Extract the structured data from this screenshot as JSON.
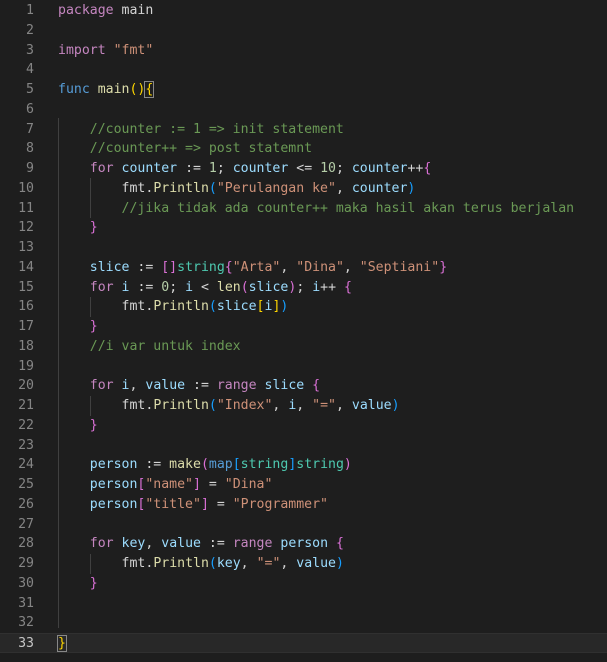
{
  "editor": {
    "language": "Go",
    "theme_background": "#1e1e1e",
    "current_line": 33,
    "lines": [
      {
        "n": "1",
        "tokens": [
          [
            "kw",
            "package"
          ],
          [
            "op",
            " "
          ],
          [
            "plain",
            "main"
          ]
        ]
      },
      {
        "n": "2",
        "tokens": []
      },
      {
        "n": "3",
        "tokens": [
          [
            "kw",
            "import"
          ],
          [
            "op",
            " "
          ],
          [
            "str",
            "\"fmt\""
          ]
        ]
      },
      {
        "n": "4",
        "tokens": []
      },
      {
        "n": "5",
        "tokens": [
          [
            "kwb",
            "func"
          ],
          [
            "op",
            " "
          ],
          [
            "fn",
            "main"
          ],
          [
            "br1",
            "()"
          ],
          [
            "br1m",
            "{"
          ]
        ]
      },
      {
        "n": "6",
        "tokens": []
      },
      {
        "n": "7",
        "tokens": [
          [
            "ws",
            "    "
          ],
          [
            "cm",
            "//counter := 1 => init statement"
          ]
        ]
      },
      {
        "n": "8",
        "tokens": [
          [
            "ws",
            "    "
          ],
          [
            "cm",
            "//counter++ => post statemnt"
          ]
        ]
      },
      {
        "n": "9",
        "tokens": [
          [
            "ws",
            "    "
          ],
          [
            "kw",
            "for"
          ],
          [
            "op",
            " "
          ],
          [
            "var",
            "counter"
          ],
          [
            "op",
            " := "
          ],
          [
            "num",
            "1"
          ],
          [
            "op",
            "; "
          ],
          [
            "var",
            "counter"
          ],
          [
            "op",
            " <= "
          ],
          [
            "num",
            "10"
          ],
          [
            "op",
            "; "
          ],
          [
            "var",
            "counter"
          ],
          [
            "op",
            "++"
          ],
          [
            "br2",
            "{"
          ]
        ]
      },
      {
        "n": "10",
        "tokens": [
          [
            "ws",
            "        "
          ],
          [
            "plain",
            "fmt"
          ],
          [
            "op",
            "."
          ],
          [
            "fn",
            "Println"
          ],
          [
            "br3",
            "("
          ],
          [
            "str",
            "\"Perulangan ke\""
          ],
          [
            "op",
            ", "
          ],
          [
            "var",
            "counter"
          ],
          [
            "br3",
            ")"
          ]
        ]
      },
      {
        "n": "11",
        "tokens": [
          [
            "ws",
            "        "
          ],
          [
            "cm",
            "//jika tidak ada counter++ maka hasil akan terus berjalan"
          ]
        ]
      },
      {
        "n": "12",
        "tokens": [
          [
            "ws",
            "    "
          ],
          [
            "br2",
            "}"
          ]
        ]
      },
      {
        "n": "13",
        "tokens": []
      },
      {
        "n": "14",
        "tokens": [
          [
            "ws",
            "    "
          ],
          [
            "var",
            "slice"
          ],
          [
            "op",
            " := "
          ],
          [
            "br2",
            "[]"
          ],
          [
            "typ",
            "string"
          ],
          [
            "br2",
            "{"
          ],
          [
            "str",
            "\"Arta\""
          ],
          [
            "op",
            ", "
          ],
          [
            "str",
            "\"Dina\""
          ],
          [
            "op",
            ", "
          ],
          [
            "str",
            "\"Septiani\""
          ],
          [
            "br2",
            "}"
          ]
        ]
      },
      {
        "n": "15",
        "tokens": [
          [
            "ws",
            "    "
          ],
          [
            "kw",
            "for"
          ],
          [
            "op",
            " "
          ],
          [
            "var",
            "i"
          ],
          [
            "op",
            " := "
          ],
          [
            "num",
            "0"
          ],
          [
            "op",
            "; "
          ],
          [
            "var",
            "i"
          ],
          [
            "op",
            " < "
          ],
          [
            "fn",
            "len"
          ],
          [
            "br2",
            "("
          ],
          [
            "var",
            "slice"
          ],
          [
            "br2",
            ")"
          ],
          [
            "op",
            "; "
          ],
          [
            "var",
            "i"
          ],
          [
            "op",
            "++ "
          ],
          [
            "br2",
            "{"
          ]
        ]
      },
      {
        "n": "16",
        "tokens": [
          [
            "ws",
            "        "
          ],
          [
            "plain",
            "fmt"
          ],
          [
            "op",
            "."
          ],
          [
            "fn",
            "Println"
          ],
          [
            "br3",
            "("
          ],
          [
            "var",
            "slice"
          ],
          [
            "br1",
            "["
          ],
          [
            "var",
            "i"
          ],
          [
            "br1",
            "]"
          ],
          [
            "br3",
            ")"
          ]
        ]
      },
      {
        "n": "17",
        "tokens": [
          [
            "ws",
            "    "
          ],
          [
            "br2",
            "}"
          ]
        ]
      },
      {
        "n": "18",
        "tokens": [
          [
            "ws",
            "    "
          ],
          [
            "cm",
            "//i var untuk index"
          ]
        ]
      },
      {
        "n": "19",
        "tokens": []
      },
      {
        "n": "20",
        "tokens": [
          [
            "ws",
            "    "
          ],
          [
            "kw",
            "for"
          ],
          [
            "op",
            " "
          ],
          [
            "var",
            "i"
          ],
          [
            "op",
            ", "
          ],
          [
            "var",
            "value"
          ],
          [
            "op",
            " := "
          ],
          [
            "kw",
            "range"
          ],
          [
            "op",
            " "
          ],
          [
            "var",
            "slice"
          ],
          [
            "op",
            " "
          ],
          [
            "br2",
            "{"
          ]
        ]
      },
      {
        "n": "21",
        "tokens": [
          [
            "ws",
            "        "
          ],
          [
            "plain",
            "fmt"
          ],
          [
            "op",
            "."
          ],
          [
            "fn",
            "Println"
          ],
          [
            "br3",
            "("
          ],
          [
            "str",
            "\"Index\""
          ],
          [
            "op",
            ", "
          ],
          [
            "var",
            "i"
          ],
          [
            "op",
            ", "
          ],
          [
            "str",
            "\"=\""
          ],
          [
            "op",
            ", "
          ],
          [
            "var",
            "value"
          ],
          [
            "br3",
            ")"
          ]
        ]
      },
      {
        "n": "22",
        "tokens": [
          [
            "ws",
            "    "
          ],
          [
            "br2",
            "}"
          ]
        ]
      },
      {
        "n": "23",
        "tokens": []
      },
      {
        "n": "24",
        "tokens": [
          [
            "ws",
            "    "
          ],
          [
            "var",
            "person"
          ],
          [
            "op",
            " := "
          ],
          [
            "fn",
            "make"
          ],
          [
            "br2",
            "("
          ],
          [
            "kwb",
            "map"
          ],
          [
            "br3",
            "["
          ],
          [
            "typ",
            "string"
          ],
          [
            "br3",
            "]"
          ],
          [
            "typ",
            "string"
          ],
          [
            "br2",
            ")"
          ]
        ]
      },
      {
        "n": "25",
        "tokens": [
          [
            "ws",
            "    "
          ],
          [
            "var",
            "person"
          ],
          [
            "br2",
            "["
          ],
          [
            "str",
            "\"name\""
          ],
          [
            "br2",
            "]"
          ],
          [
            "op",
            " = "
          ],
          [
            "str",
            "\"Dina\""
          ]
        ]
      },
      {
        "n": "26",
        "tokens": [
          [
            "ws",
            "    "
          ],
          [
            "var",
            "person"
          ],
          [
            "br2",
            "["
          ],
          [
            "str",
            "\"title\""
          ],
          [
            "br2",
            "]"
          ],
          [
            "op",
            " = "
          ],
          [
            "str",
            "\"Programmer\""
          ]
        ]
      },
      {
        "n": "27",
        "tokens": []
      },
      {
        "n": "28",
        "tokens": [
          [
            "ws",
            "    "
          ],
          [
            "kw",
            "for"
          ],
          [
            "op",
            " "
          ],
          [
            "var",
            "key"
          ],
          [
            "op",
            ", "
          ],
          [
            "var",
            "value"
          ],
          [
            "op",
            " := "
          ],
          [
            "kw",
            "range"
          ],
          [
            "op",
            " "
          ],
          [
            "var",
            "person"
          ],
          [
            "op",
            " "
          ],
          [
            "br2",
            "{"
          ]
        ]
      },
      {
        "n": "29",
        "tokens": [
          [
            "ws",
            "        "
          ],
          [
            "plain",
            "fmt"
          ],
          [
            "op",
            "."
          ],
          [
            "fn",
            "Println"
          ],
          [
            "br3",
            "("
          ],
          [
            "var",
            "key"
          ],
          [
            "op",
            ", "
          ],
          [
            "str",
            "\"=\""
          ],
          [
            "op",
            ", "
          ],
          [
            "var",
            "value"
          ],
          [
            "br3",
            ")"
          ]
        ]
      },
      {
        "n": "30",
        "tokens": [
          [
            "ws",
            "    "
          ],
          [
            "br2",
            "}"
          ]
        ]
      },
      {
        "n": "31",
        "tokens": []
      },
      {
        "n": "32",
        "tokens": []
      },
      {
        "n": "33",
        "tokens": [
          [
            "br1m",
            "}"
          ]
        ]
      }
    ]
  }
}
